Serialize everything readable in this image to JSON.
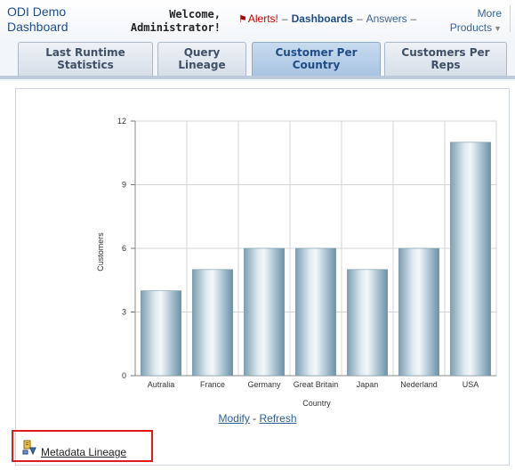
{
  "header": {
    "app_title_line1": "ODI Demo",
    "app_title_line2": "Dashboard",
    "welcome_line1": "Welcome,",
    "welcome_line2": "Administrator!",
    "alerts_label": "Alerts!",
    "separator": "–",
    "dashboards_label": "Dashboards",
    "answers_label": "Answers",
    "more_line1": "More",
    "more_line2": "Products",
    "alert_color": "#cc0000",
    "brand_color": "#1f4c86"
  },
  "tabs": [
    {
      "line1": "Last Runtime",
      "line2": "Statistics",
      "active": false
    },
    {
      "line1": "Query",
      "line2": "Lineage",
      "active": false
    },
    {
      "line1": "Customer Per",
      "line2": "Country",
      "active": true
    },
    {
      "line1": "Customers Per",
      "line2": "Reps",
      "active": false
    }
  ],
  "chart_data": {
    "type": "bar",
    "categories": [
      "Autralia",
      "France",
      "Germany",
      "Great Britain",
      "Japan",
      "Nederland",
      "USA"
    ],
    "values": [
      4,
      5,
      6,
      6,
      5,
      6,
      11
    ],
    "xlabel": "Country",
    "ylabel": "Customers",
    "ylim": [
      0,
      12
    ],
    "yticks": [
      0,
      3,
      6,
      9,
      12
    ],
    "grid": true,
    "bar_color": "#9fbccd"
  },
  "chart_links": {
    "modify": "Modify",
    "separator": "-",
    "refresh": "Refresh"
  },
  "metadata": {
    "label": "Metadata Lineage",
    "icon": "metadata-lineage-icon",
    "highlight_color": "#e01b1b"
  }
}
